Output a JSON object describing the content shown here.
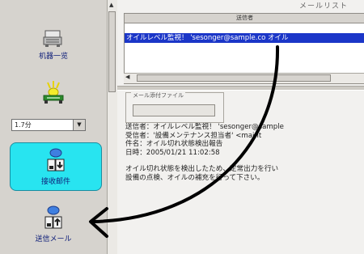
{
  "sidebar": {
    "device_list_label": "机器一览",
    "alarm_combo_value": "1.7分",
    "received_mail_label": "接收邮件",
    "sent_mail_label": "送信メール"
  },
  "mail_list": {
    "title": "メールリスト",
    "column_header": "送信者",
    "selected_row": "オイルレベル監視！ 'sesonger@sample.co オイル"
  },
  "detail": {
    "group_label": "メール添付ファイル",
    "lines": [
      "送信者：オイルレベル監視！ 'sesonger@sample",
      "受信者：'設備メンテナンス担当者' <maint",
      "件名：オイル切れ状態検出報告",
      "日時：2005/01/21 11:02:58"
    ],
    "body_lines": [
      "オイル切れ状態を検出したため、定常出力を行い",
      "設備の点検、オイルの補充を行って下さい。"
    ]
  },
  "colors": {
    "selection": "#1b36c8",
    "received_highlight": "#28e4f0",
    "annotation_arrow": "#000000"
  }
}
